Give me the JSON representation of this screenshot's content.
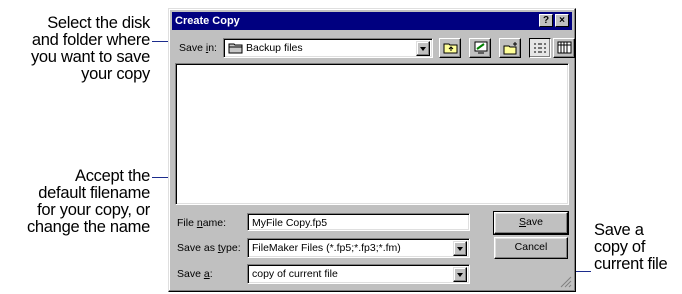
{
  "callouts": {
    "save_in": [
      "Select the disk",
      "and folder where",
      "you want to save",
      "your copy"
    ],
    "file_name": [
      "Accept the",
      "default filename",
      "for your copy, or",
      "change the name"
    ],
    "save_a": [
      "Save a",
      "copy of",
      "current file"
    ]
  },
  "dialog": {
    "title": "Create Copy",
    "help_glyph": "?",
    "close_glyph": "×",
    "save_in_label_pre": "Save ",
    "save_in_label_key": "i",
    "save_in_label_post": "n:",
    "save_in_value": "Backup files",
    "file_name_label_pre": "File ",
    "file_name_label_key": "n",
    "file_name_label_post": "ame:",
    "file_name_value": "MyFile Copy.fp5",
    "save_type_label_pre": "Save as ",
    "save_type_label_key": "t",
    "save_type_label_post": "ype:",
    "save_type_value": "FileMaker Files (*.fp5;*.fp3;*.fm)",
    "save_a_label_pre": "Save ",
    "save_a_label_key": "a",
    "save_a_label_post": ":",
    "save_a_value": "copy of current file",
    "save_button_key": "S",
    "save_button_rest": "ave",
    "cancel_button": "Cancel"
  },
  "icons": {
    "folder": "folder-icon",
    "up_one_level": "up-one-level-icon",
    "desktop": "desktop-icon",
    "new_folder": "new-folder-icon",
    "list_view": "list-view-icon",
    "details_view": "details-view-icon"
  },
  "colors": {
    "title_bar": "#000080",
    "dialog_face": "#c0c0c0",
    "leader_line": "#1c2c8c"
  }
}
